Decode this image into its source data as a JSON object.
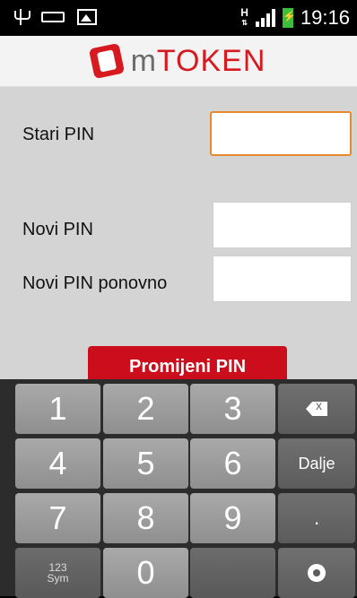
{
  "status_bar": {
    "network_type": "H",
    "time": "19:16"
  },
  "header": {
    "logo_m": "m",
    "logo_token": "TOKEN"
  },
  "form": {
    "old_pin_label": "Stari PIN",
    "new_pin_label": "Novi PIN",
    "confirm_pin_label": "Novi PIN ponovno",
    "submit_label": "Promijeni PIN"
  },
  "keyboard": {
    "keys": [
      "1",
      "2",
      "3",
      "4",
      "5",
      "6",
      "7",
      "8",
      "9",
      "0",
      "."
    ],
    "next_label": "Dalje",
    "symbols_top": "123",
    "symbols_bottom": "Sym"
  },
  "colors": {
    "accent_red": "#cc0e1c",
    "focus_orange": "#e68a2e",
    "form_background": "#d4d4d4"
  }
}
